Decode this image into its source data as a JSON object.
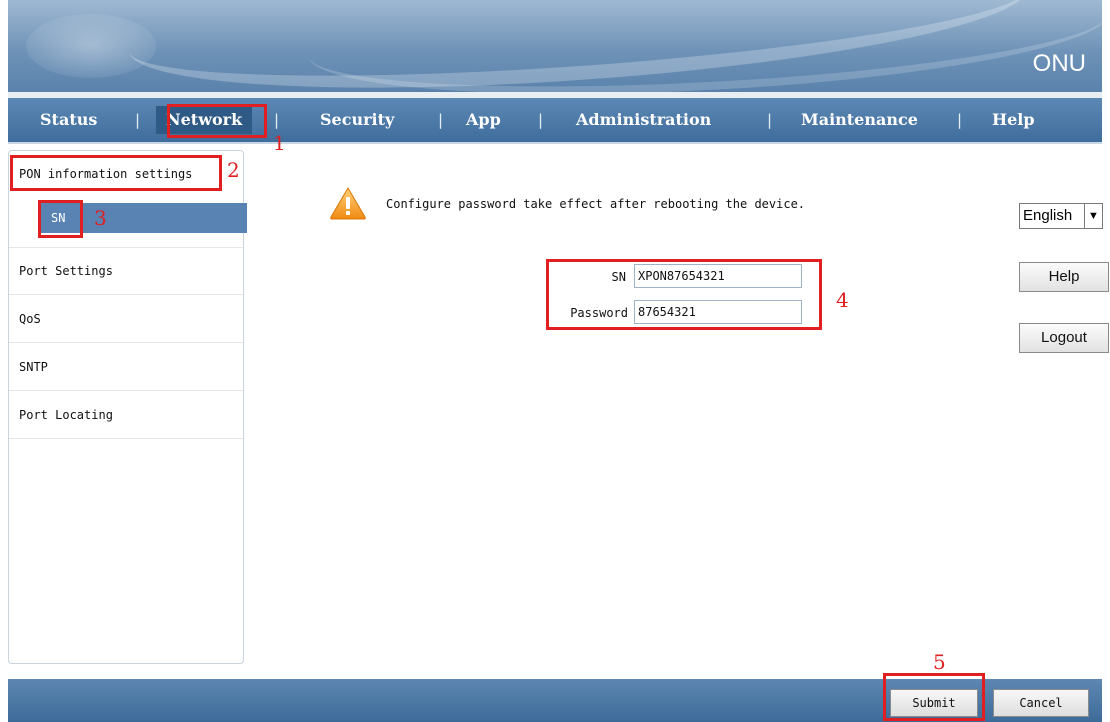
{
  "header": {
    "brand": "ONU"
  },
  "nav": {
    "items": [
      {
        "label": "Status"
      },
      {
        "label": "Network"
      },
      {
        "label": "Security"
      },
      {
        "label": "App"
      },
      {
        "label": "Administration"
      },
      {
        "label": "Maintenance"
      },
      {
        "label": "Help"
      }
    ],
    "separator": "|",
    "active": "Network"
  },
  "sidebar": {
    "items": [
      {
        "label": "PON information settings"
      },
      {
        "label": "Port Settings"
      },
      {
        "label": "QoS"
      },
      {
        "label": "SNTP"
      },
      {
        "label": "Port Locating"
      }
    ],
    "sub_items": [
      {
        "label": "SN"
      }
    ]
  },
  "notice": {
    "text": "Configure password take effect after rebooting the device.",
    "icon": "warning-icon"
  },
  "form": {
    "sn_label": "SN",
    "sn_value": "XPON87654321",
    "password_label": "Password",
    "password_value": "87654321"
  },
  "controls": {
    "language": "English",
    "help_label": "Help",
    "logout_label": "Logout"
  },
  "footer": {
    "submit_label": "Submit",
    "cancel_label": "Cancel"
  },
  "annotations": [
    "1",
    "2",
    "3",
    "4",
    "5"
  ],
  "colors": {
    "nav_bg": "#3f6d9c",
    "active_bg": "#2f5a85",
    "highlight": "#5883b2",
    "annotation_red": "#e02020"
  }
}
